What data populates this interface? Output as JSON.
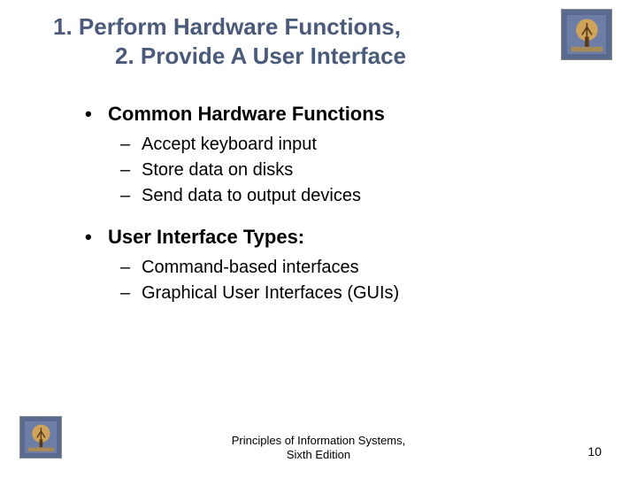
{
  "title": {
    "line1": "1. Perform Hardware Functions,",
    "line2": "2. Provide A User Interface"
  },
  "bullets": [
    {
      "heading": "Common Hardware Functions",
      "items": [
        "Accept keyboard input",
        "Store data on disks",
        "Send data to output devices"
      ]
    },
    {
      "heading": "User Interface Types:",
      "items": [
        "Command-based interfaces",
        "Graphical User Interfaces (GUIs)"
      ]
    }
  ],
  "footer": {
    "line1": "Principles of Information Systems,",
    "line2": "Sixth Edition"
  },
  "page_number": "10",
  "icons": {
    "logo": "tree-logo-icon"
  }
}
